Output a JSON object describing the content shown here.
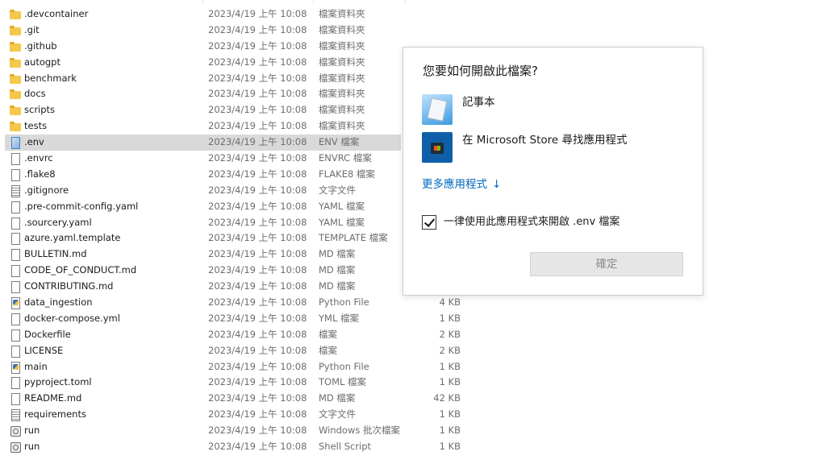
{
  "files": [
    {
      "name": ".devcontainer",
      "date": "2023/4/19 上午 10:08",
      "type": "檔案資料夾",
      "size": "",
      "icon": "folder-icon"
    },
    {
      "name": ".git",
      "date": "2023/4/19 上午 10:08",
      "type": "檔案資料夾",
      "size": "",
      "icon": "folder-icon"
    },
    {
      "name": ".github",
      "date": "2023/4/19 上午 10:08",
      "type": "檔案資料夾",
      "size": "",
      "icon": "folder-icon"
    },
    {
      "name": "autogpt",
      "date": "2023/4/19 上午 10:08",
      "type": "檔案資料夾",
      "size": "",
      "icon": "folder-icon"
    },
    {
      "name": "benchmark",
      "date": "2023/4/19 上午 10:08",
      "type": "檔案資料夾",
      "size": "",
      "icon": "folder-icon"
    },
    {
      "name": "docs",
      "date": "2023/4/19 上午 10:08",
      "type": "檔案資料夾",
      "size": "",
      "icon": "folder-icon"
    },
    {
      "name": "scripts",
      "date": "2023/4/19 上午 10:08",
      "type": "檔案資料夾",
      "size": "",
      "icon": "folder-icon"
    },
    {
      "name": "tests",
      "date": "2023/4/19 上午 10:08",
      "type": "檔案資料夾",
      "size": "",
      "icon": "folder-icon"
    },
    {
      "name": ".env",
      "date": "2023/4/19 上午 10:08",
      "type": "ENV 檔案",
      "size": "",
      "icon": "env-file-icon",
      "selected": true
    },
    {
      "name": ".envrc",
      "date": "2023/4/19 上午 10:08",
      "type": "ENVRC 檔案",
      "size": "",
      "icon": "file-icon"
    },
    {
      "name": ".flake8",
      "date": "2023/4/19 上午 10:08",
      "type": "FLAKE8 檔案",
      "size": "",
      "icon": "file-icon"
    },
    {
      "name": ".gitignore",
      "date": "2023/4/19 上午 10:08",
      "type": "文字文件",
      "size": "",
      "icon": "text-file-icon"
    },
    {
      "name": ".pre-commit-config.yaml",
      "date": "2023/4/19 上午 10:08",
      "type": "YAML 檔案",
      "size": "",
      "icon": "file-icon"
    },
    {
      "name": ".sourcery.yaml",
      "date": "2023/4/19 上午 10:08",
      "type": "YAML 檔案",
      "size": "",
      "icon": "file-icon"
    },
    {
      "name": "azure.yaml.template",
      "date": "2023/4/19 上午 10:08",
      "type": "TEMPLATE 檔案",
      "size": "",
      "icon": "file-icon"
    },
    {
      "name": "BULLETIN.md",
      "date": "2023/4/19 上午 10:08",
      "type": "MD 檔案",
      "size": "",
      "icon": "file-icon"
    },
    {
      "name": "CODE_OF_CONDUCT.md",
      "date": "2023/4/19 上午 10:08",
      "type": "MD 檔案",
      "size": "",
      "icon": "file-icon"
    },
    {
      "name": "CONTRIBUTING.md",
      "date": "2023/4/19 上午 10:08",
      "type": "MD 檔案",
      "size": "",
      "icon": "file-icon"
    },
    {
      "name": "data_ingestion",
      "date": "2023/4/19 上午 10:08",
      "type": "Python File",
      "size": "4 KB",
      "icon": "python-file-icon"
    },
    {
      "name": "docker-compose.yml",
      "date": "2023/4/19 上午 10:08",
      "type": "YML 檔案",
      "size": "1 KB",
      "icon": "file-icon"
    },
    {
      "name": "Dockerfile",
      "date": "2023/4/19 上午 10:08",
      "type": "檔案",
      "size": "2 KB",
      "icon": "file-icon"
    },
    {
      "name": "LICENSE",
      "date": "2023/4/19 上午 10:08",
      "type": "檔案",
      "size": "2 KB",
      "icon": "file-icon"
    },
    {
      "name": "main",
      "date": "2023/4/19 上午 10:08",
      "type": "Python File",
      "size": "1 KB",
      "icon": "python-file-icon"
    },
    {
      "name": "pyproject.toml",
      "date": "2023/4/19 上午 10:08",
      "type": "TOML 檔案",
      "size": "1 KB",
      "icon": "file-icon"
    },
    {
      "name": "README.md",
      "date": "2023/4/19 上午 10:08",
      "type": "MD 檔案",
      "size": "42 KB",
      "icon": "file-icon"
    },
    {
      "name": "requirements",
      "date": "2023/4/19 上午 10:08",
      "type": "文字文件",
      "size": "1 KB",
      "icon": "text-file-icon"
    },
    {
      "name": "run",
      "date": "2023/4/19 上午 10:08",
      "type": "Windows 批次檔案",
      "size": "1 KB",
      "icon": "batch-file-icon"
    },
    {
      "name": "run",
      "date": "2023/4/19 上午 10:08",
      "type": "Shell Script",
      "size": "1 KB",
      "icon": "batch-file-icon"
    }
  ],
  "dialog": {
    "title": "您要如何開啟此檔案?",
    "apps": [
      {
        "label": "記事本",
        "icon": "notepad-icon"
      },
      {
        "label": "在 Microsoft Store 尋找應用程式",
        "icon": "microsoft-store-icon"
      }
    ],
    "more_apps": "更多應用程式",
    "more_apps_arrow": "↓",
    "always_use_label": "一律使用此應用程式來開啟 .env 檔案",
    "always_use_checked": true,
    "ok_label": "確定"
  }
}
